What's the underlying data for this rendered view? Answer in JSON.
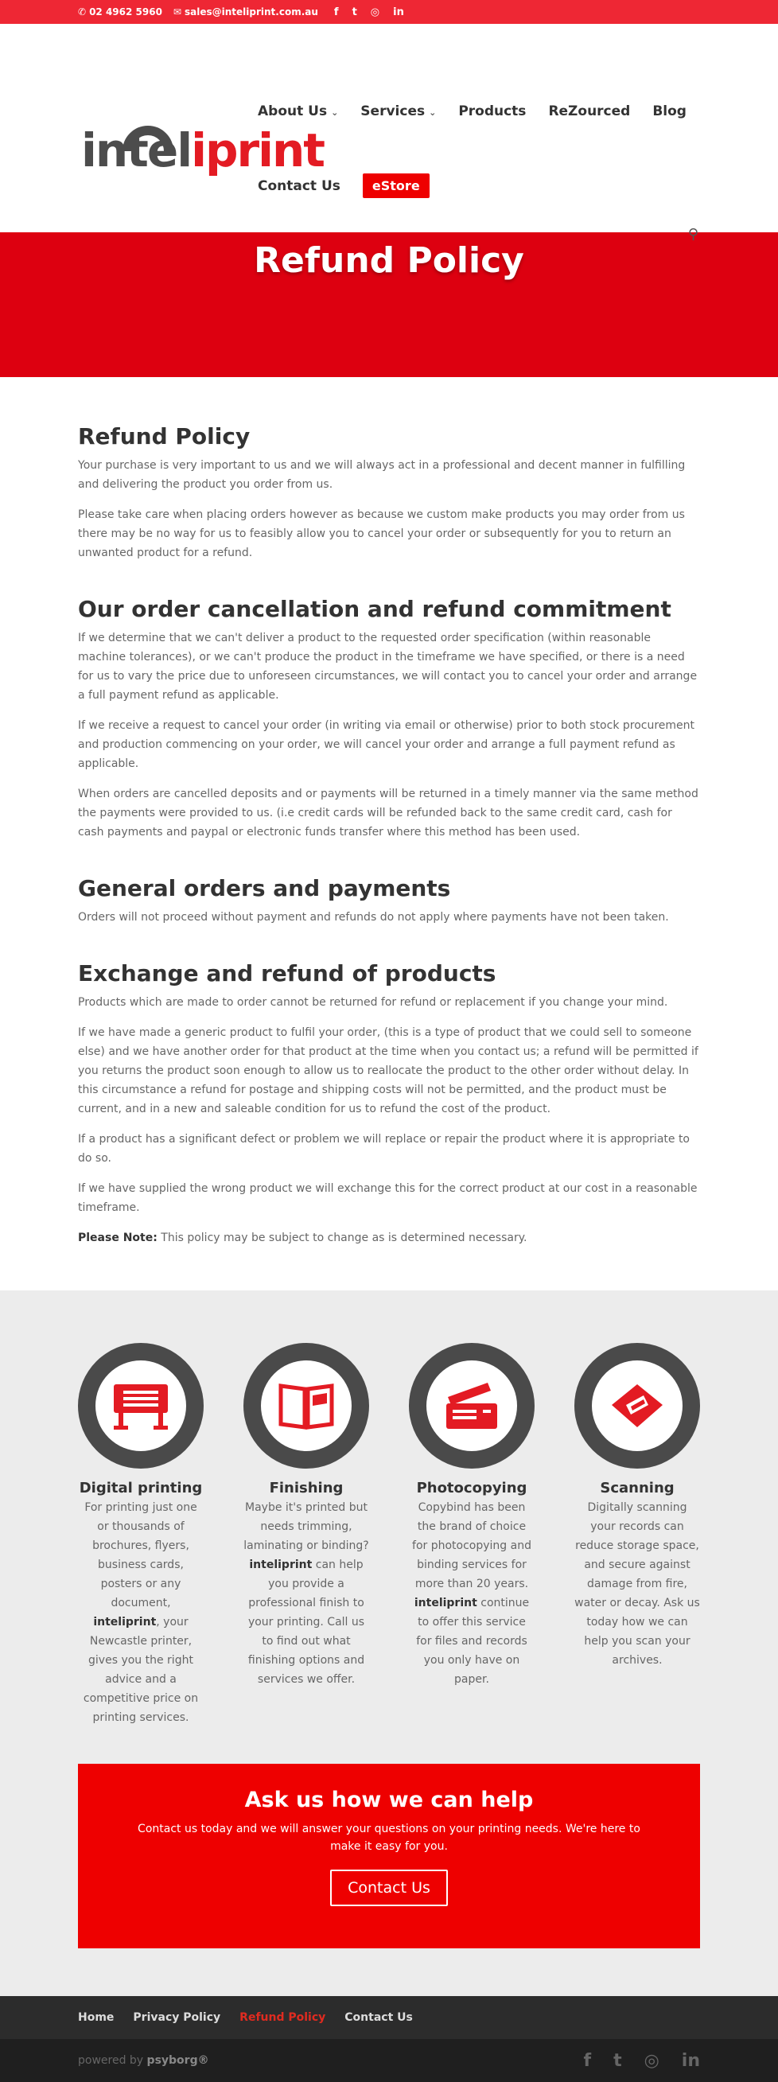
{
  "topbar": {
    "phone": "02 4962 5960",
    "email": "sales@inteliprint.com.au",
    "social_icons": [
      "facebook-icon",
      "twitter-icon",
      "instagram-icon",
      "linkedin-icon"
    ],
    "social_glyphs": [
      "f",
      "t",
      "◎",
      "in"
    ]
  },
  "brand": {
    "logo_part1": "intel",
    "logo_part2": "iprint",
    "primary_color": "#e31b23",
    "dark_color": "#4c4c4c"
  },
  "nav": {
    "items": [
      {
        "label": "About Us",
        "has_dropdown": true
      },
      {
        "label": "Services",
        "has_dropdown": true
      },
      {
        "label": "Products",
        "has_dropdown": false
      },
      {
        "label": "ReZourced",
        "has_dropdown": false
      },
      {
        "label": "Blog",
        "has_dropdown": false
      },
      {
        "label": "Contact Us",
        "has_dropdown": false
      },
      {
        "label": "eStore",
        "has_dropdown": false
      }
    ]
  },
  "hero": {
    "title": "Refund Policy"
  },
  "content": {
    "sections": [
      {
        "heading": "Refund Policy",
        "paragraphs": [
          "Your purchase is very important to us and we will always act in a professional and decent manner in fulfilling and delivering the product you order from us.",
          "Please take care when placing orders however as because we custom make products you may order from us there may be no way for us to feasibly allow you to cancel your order or subsequently for you to return an unwanted product for a refund."
        ]
      },
      {
        "heading": "Our order cancellation and refund commitment",
        "paragraphs": [
          "If we determine that we can't deliver a product to the requested order specification (within reasonable machine tolerances), or we can't produce the product in the timeframe we have specified, or there is a need for us to vary the price due to unforeseen circumstances, we will contact you to cancel your order and arrange a full payment refund as applicable.",
          "If we receive a request to cancel your order (in writing via email or otherwise) prior to both stock procurement and production commencing on your order, we will cancel your order and arrange a full payment refund as applicable.",
          "When orders are cancelled deposits and or payments will be returned in a timely manner via the same method the payments were provided to us. (i.e credit cards will be refunded back to the same credit card, cash for cash payments and paypal or electronic funds transfer where this method has been used."
        ]
      },
      {
        "heading": "General orders and payments",
        "paragraphs": [
          "Orders will not proceed without payment and refunds do not apply where payments have not been taken."
        ]
      },
      {
        "heading": "Exchange and refund of products",
        "paragraphs": [
          "Products which are made to order cannot be returned for refund or replacement if you change your mind.",
          "If we have made a generic product to fulfil your order, (this is a type of product that we could sell to someone else) and we have another order for that product at the time when you contact us; a refund will be permitted if you returns the product soon enough to allow us to reallocate the product to the other order without delay. In this circumstance a refund for postage and shipping costs will not be permitted, and the product must be current, and in a new and saleable condition for us to refund the cost of the product.",
          "If a product has a significant defect or problem we will replace or repair the product where it is appropriate to do so.",
          "If we have supplied the wrong product we will exchange this for the correct product at our cost in a reasonable timeframe."
        ]
      }
    ],
    "note_label": "Please Note:",
    "note_text": " This policy may be subject to change as is determined necessary."
  },
  "services": [
    {
      "title": "Digital printing",
      "icon": "printer-icon",
      "text_before": "For printing just one or thousands of brochures, flyers, business cards, posters or any document, ",
      "bold": "inteliprint",
      "text_after": ", your Newcastle printer, gives you the right advice and a competitive price on printing services."
    },
    {
      "title": "Finishing",
      "icon": "book-icon",
      "text_before": "Maybe it's printed but needs trimming, laminating or binding? ",
      "bold": "inteliprint",
      "text_after": " can help you provide a professional finish to your printing. Call us to find out what finishing options and services we offer."
    },
    {
      "title": "Photocopying",
      "icon": "copier-icon",
      "text_before": "Copybind has been the brand of choice for photocopying and binding services for more than 20 years. ",
      "bold": "inteliprint",
      "text_after": " continue to offer this service for files and records you only have on paper."
    },
    {
      "title": "Scanning",
      "icon": "scanner-icon",
      "text_before": "Digitally scanning your records can reduce storage space, and secure against damage from fire, water or decay. Ask us today how we can help you scan your archives.",
      "bold": "",
      "text_after": ""
    }
  ],
  "cta": {
    "title": "Ask us how we can help",
    "text": "Contact us today and we will answer your questions on your printing needs. We're here to make it easy for you.",
    "button": "Contact Us"
  },
  "footer": {
    "links": [
      {
        "label": "Home",
        "active": false
      },
      {
        "label": "Privacy Policy",
        "active": false
      },
      {
        "label": "Refund Policy",
        "active": true
      },
      {
        "label": "Contact Us",
        "active": false
      }
    ],
    "powered_by": "powered by ",
    "powered_brand": "psyborg®",
    "social_glyphs": [
      "f",
      "t",
      "◎",
      "in"
    ]
  }
}
